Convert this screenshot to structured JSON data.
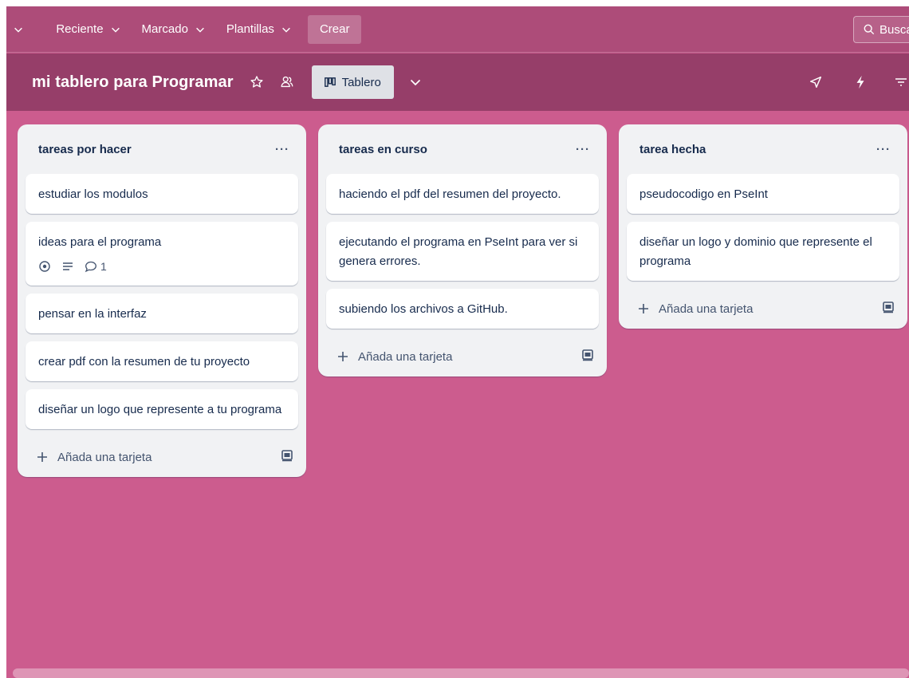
{
  "topnav": {
    "cut_chevron": "",
    "items": [
      {
        "label": "Reciente"
      },
      {
        "label": "Marcado"
      },
      {
        "label": "Plantillas"
      }
    ],
    "create_label": "Crear",
    "search_placeholder": "Busca"
  },
  "board": {
    "title": "mi tablero para Programar",
    "view_label": "Tablero"
  },
  "lists": [
    {
      "title": "tareas por hacer",
      "menu": "···",
      "cards": [
        {
          "text": "estudiar los modulos"
        },
        {
          "text": "ideas para el programa",
          "badges": {
            "comments": "1"
          }
        },
        {
          "text": "pensar en la interfaz"
        },
        {
          "text": "crear pdf con la resumen de tu proyecto"
        },
        {
          "text": "diseñar un logo que represente a tu programa"
        }
      ],
      "add_label": "Añada una tarjeta"
    },
    {
      "title": "tareas en curso",
      "menu": "···",
      "cards": [
        {
          "text": "haciendo el pdf del resumen del proyecto."
        },
        {
          "text": "ejecutando el programa en PseInt para ver si genera errores."
        },
        {
          "text": "subiendo los archivos a GitHub."
        }
      ],
      "add_label": "Añada una tarjeta"
    },
    {
      "title": "tarea hecha",
      "menu": "···",
      "cards": [
        {
          "text": "pseudocodigo en PseInt"
        },
        {
          "text": "diseñar un logo y dominio que represente el programa"
        }
      ],
      "add_label": "Añada una tarjeta"
    }
  ],
  "colors": {
    "board_bg": "#cc5c8e",
    "topnav_bg": "#ad4c79",
    "boardbar_bg": "#963e69",
    "list_bg": "#f1f2f4"
  },
  "icons": {
    "star": "star-icon",
    "members": "members-icon",
    "board_view": "board-view-icon",
    "rocket": "power-ups-icon",
    "automation": "automation-icon",
    "filter": "filter-icon",
    "watch": "eye-icon",
    "description": "description-icon",
    "comment": "comment-icon",
    "template": "card-template-icon",
    "add": "plus-icon"
  }
}
